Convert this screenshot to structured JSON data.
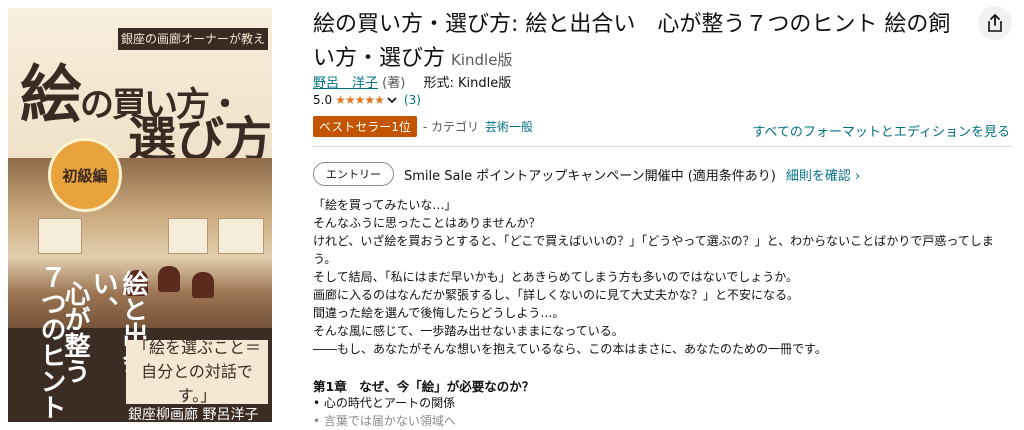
{
  "cover": {
    "banner": "銀座の画廊オーナーが教える",
    "title_line1_big": "絵",
    "title_line1_small": "の買い方・",
    "title_line2": "選び方",
    "level_badge": "初級編",
    "vertical_left": "７つのヒント",
    "vertical_mid": "心が整う",
    "vertical_right": "絵と出会い、",
    "quote": "「絵を選ぶこと＝自分との対話です。」",
    "author": "銀座柳画廊 野呂洋子"
  },
  "product": {
    "title": "絵の買い方・選び方: 絵と出合い　心が整う７つのヒント 絵の飼い方・選び方",
    "format_label": "Kindle版",
    "author_name": "野呂　洋子",
    "author_role": "(著)",
    "format_prefix": "形式:",
    "format_value": "Kindle版",
    "rating_value": "5.0",
    "stars": "★★★★★",
    "rating_count": "(3)",
    "bestseller_badge": "ベストセラー1位",
    "category_prefix": "- カテゴリ",
    "category_link": "芸術一般",
    "all_formats_link": "すべてのフォーマットとエディションを見る",
    "share_icon": "share-icon"
  },
  "promo": {
    "entry_button": "エントリー",
    "text": "Smile Sale ポイントアップキャンペーン開催中 (適用条件あり)",
    "details_link": "細則を確認 ›"
  },
  "description": {
    "lines": [
      "「絵を買ってみたいな…」",
      "そんなふうに思ったことはありませんか？",
      "けれど、いざ絵を買おうとすると、「どこで買えばいいの？」「どうやって選ぶの？」と、わからないことばかりで戸惑ってしまう。",
      "そして結局、「私にはまだ早いかも」とあきらめてしまう方も多いのではないでしょうか。",
      "画廊に入るのはなんだか緊張するし、「詳しくないのに見て大丈夫かな？」と不安になる。",
      "間違った絵を選んで後悔したらどうしよう…。",
      "そんな風に感じて、一歩踏み出せないままになっている。",
      "――もし、あなたがそんな想いを抱えているなら、この本はまさに、あなたのための一冊です。"
    ],
    "chapter_heading": "第1章　なぜ、今「絵」が必要なのか？",
    "bullets": [
      "心の時代とアートの関係",
      "言葉では届かない領域へ"
    ]
  }
}
